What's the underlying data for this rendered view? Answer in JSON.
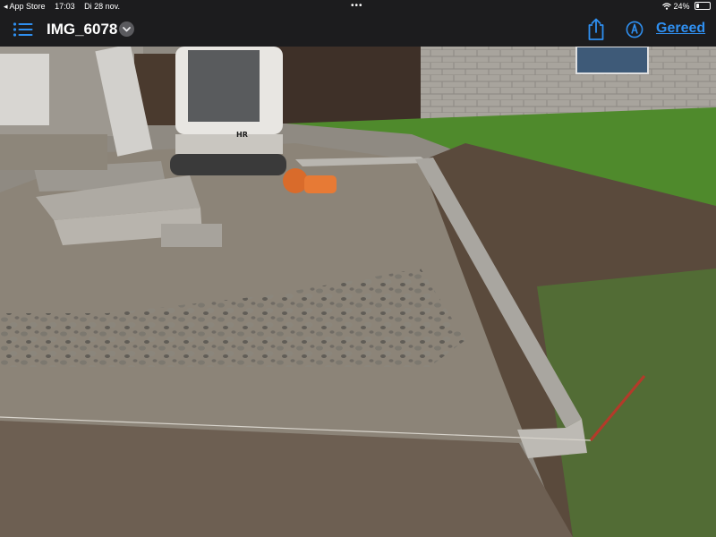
{
  "status_bar": {
    "back_app": "◂ App Store",
    "time": "17:03",
    "date": "Di 28 nov.",
    "dots": "•••",
    "battery_text": "24%",
    "battery_level": 0.24
  },
  "toolbar": {
    "title": "IMG_6078",
    "done_label": "Gereed"
  },
  "icons": {
    "list": "list-icon",
    "chevron": "chevron-down-icon",
    "share": "share-icon",
    "markup": "markup-icon",
    "wifi": "wifi-icon"
  },
  "photo": {
    "excavator_label": "HR"
  },
  "colors": {
    "accent": "#2f8ff0",
    "bar_background": "#1c1c1e"
  }
}
